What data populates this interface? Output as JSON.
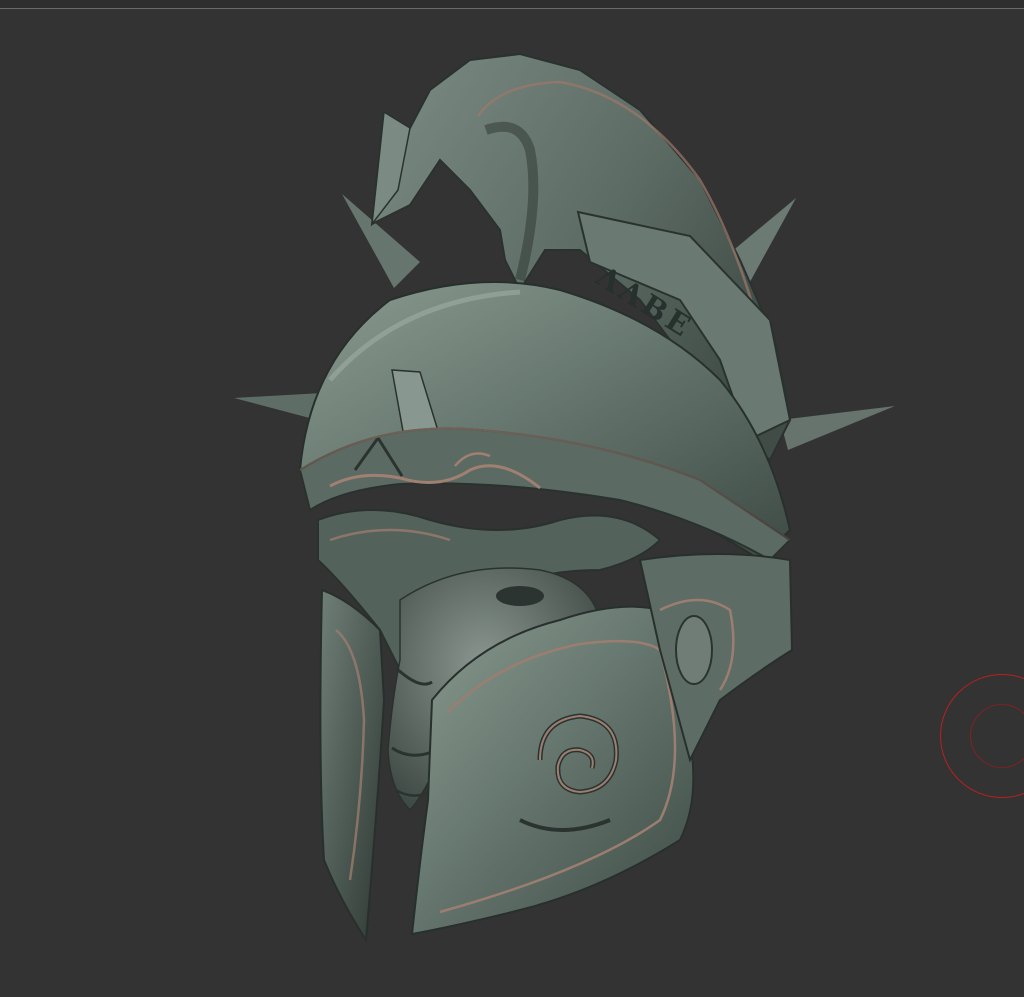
{
  "viewport": {
    "background": "#333333"
  },
  "model": {
    "name_icon": "spartan-helmet-sculpt",
    "material_color": "#68786f",
    "crest_inscription": "ΛΛΒΕ"
  },
  "brush_cursor": {
    "color": "#b82020",
    "icon": "brush-cursor-icon"
  }
}
